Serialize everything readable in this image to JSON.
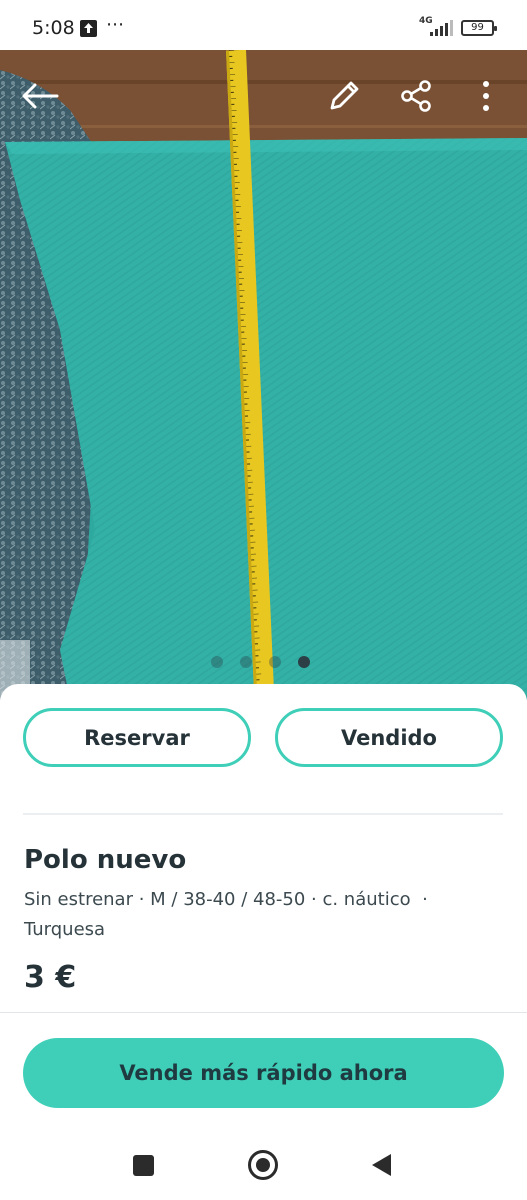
{
  "status_bar": {
    "time": "5:08",
    "overflow": "⋯",
    "network": "4G",
    "battery": "99"
  },
  "photo": {
    "icons": [
      "back-arrow-icon",
      "pencil-icon",
      "share-icon",
      "more-vertical-icon"
    ],
    "pager": {
      "total": 4,
      "active_index": 3
    },
    "colors": {
      "shirt": "#34b4aa",
      "rug": "#40606e",
      "tape": "#e8c820",
      "floor": "#7a5134"
    }
  },
  "actions": {
    "reserve_label": "Reservar",
    "sold_label": "Vendido"
  },
  "listing": {
    "title": "Polo nuevo",
    "attributes": "Sin estrenar · M / 38-40 / 48-50 · c. náutico  · Turquesa",
    "price": "3 €"
  },
  "cta": {
    "label": "Vende más rápido ahora",
    "color": "#3fcfb8"
  },
  "nav_bar": {
    "icons": [
      "recents-square-icon",
      "home-circle-icon",
      "back-triangle-icon"
    ]
  }
}
